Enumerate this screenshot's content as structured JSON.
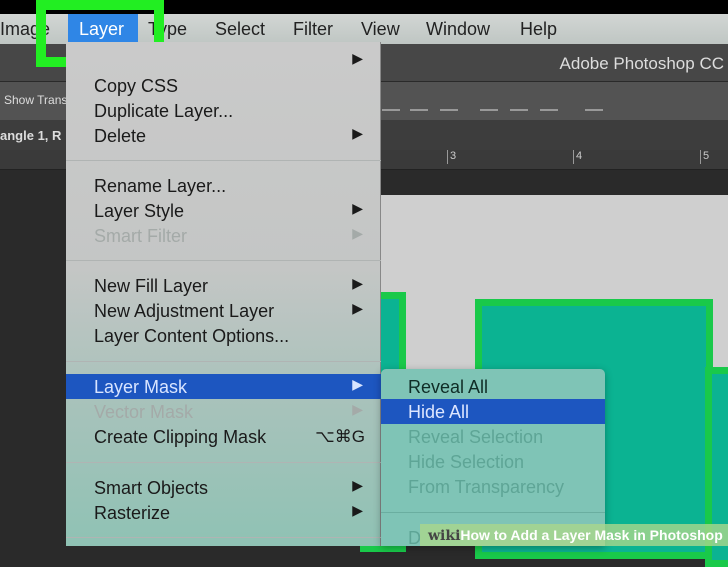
{
  "menubar": {
    "items": [
      "Image",
      "Layer",
      "Type",
      "Select",
      "Filter",
      "View",
      "Window",
      "Help"
    ],
    "active": "Layer"
  },
  "app_title": "Adobe Photoshop CC",
  "options_bar": {
    "show_transform": "Show Trans"
  },
  "doc_tab": "angle 1, R",
  "ruler": [
    "3",
    "4",
    "5"
  ],
  "layer_menu": {
    "items": [
      {
        "arrow": true
      },
      {
        "label": "Copy CSS"
      },
      {
        "label": "Duplicate Layer..."
      },
      {
        "label": "Delete",
        "arrow": true
      },
      {
        "label": "Rename Layer..."
      },
      {
        "label": "Layer Style",
        "arrow": true
      },
      {
        "label": "Smart Filter",
        "arrow": true,
        "disabled": true
      },
      {
        "label": "New Fill Layer",
        "arrow": true
      },
      {
        "label": "New Adjustment Layer",
        "arrow": true
      },
      {
        "label": "Layer Content Options..."
      },
      {
        "label": "Layer Mask",
        "arrow": true,
        "highlighted": true
      },
      {
        "label": "Vector Mask",
        "arrow": true,
        "disabled": true
      },
      {
        "label": "Create Clipping Mask",
        "shortcut": "⌥⌘G"
      },
      {
        "label": "Smart Objects",
        "arrow": true
      },
      {
        "label": "Rasterize",
        "arrow": true
      }
    ]
  },
  "layer_mask_submenu": {
    "items": [
      {
        "label": "Reveal All"
      },
      {
        "label": "Hide All",
        "highlighted": true
      },
      {
        "label": "Reveal Selection",
        "disabled": true
      },
      {
        "label": "Hide Selection",
        "disabled": true
      },
      {
        "label": "From Transparency",
        "disabled": true
      },
      {
        "label": "D",
        "disabled": true
      }
    ]
  },
  "watermark": {
    "brand": "wiki",
    "text": "How to Add a Layer Mask in Photoshop"
  },
  "colors": {
    "highlight": "#1d56c0",
    "active_menu": "#2f86e6",
    "callout": "#22ee22",
    "shape_fill": "#0bb392"
  }
}
